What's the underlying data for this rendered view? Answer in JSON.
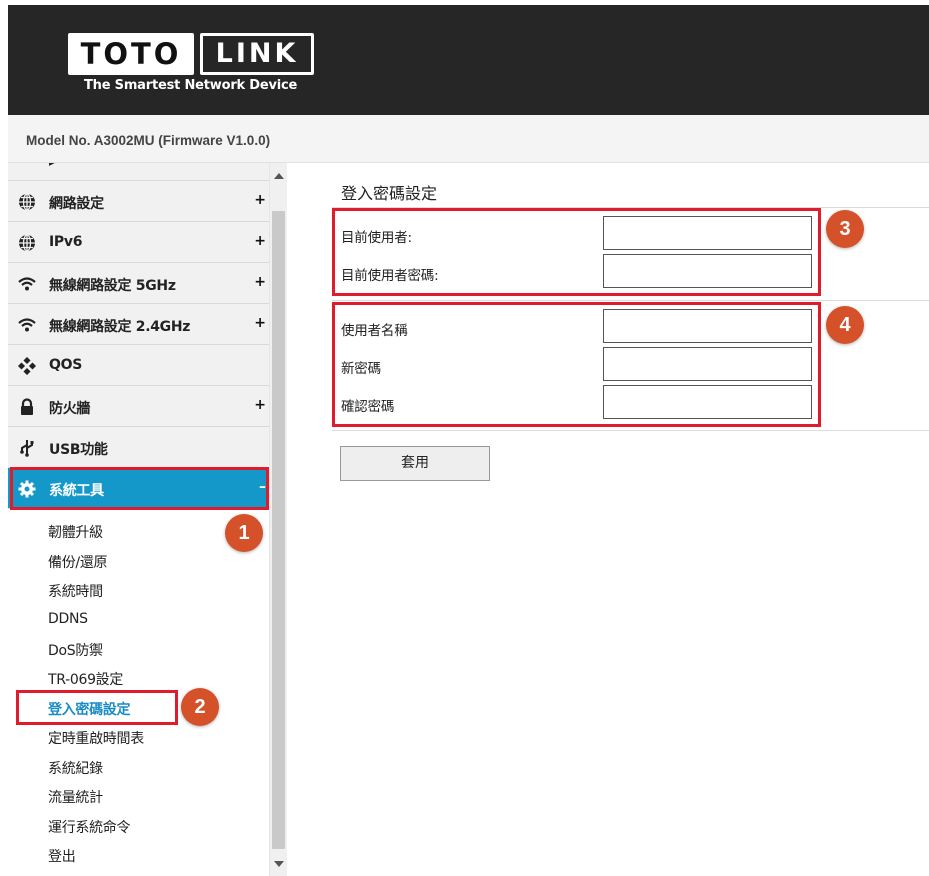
{
  "header": {
    "logo_left": "TOTO",
    "logo_right": "LINK",
    "tagline": "The Smartest Network Device",
    "model": "Model No. A3002MU (Firmware V1.0.0)"
  },
  "sidebar": {
    "items": [
      {
        "label": "網路設定",
        "icon": "globe-icon",
        "toggle": "+"
      },
      {
        "label": "IPv6",
        "icon": "globe-icon",
        "toggle": "+"
      },
      {
        "label": "無線網路設定 5GHz",
        "icon": "wifi-icon",
        "toggle": "+"
      },
      {
        "label": "無線網路設定 2.4GHz",
        "icon": "wifi-icon",
        "toggle": "+"
      },
      {
        "label": "QOS",
        "icon": "qos-icon",
        "toggle": ""
      },
      {
        "label": "防火牆",
        "icon": "lock-icon",
        "toggle": "+"
      },
      {
        "label": "USB功能",
        "icon": "usb-icon",
        "toggle": ""
      },
      {
        "label": "系統工具",
        "icon": "gear-icon",
        "toggle": "–"
      }
    ],
    "subitems": [
      "韌體升級",
      "備份/還原",
      "系統時間",
      "DDNS",
      "DoS防禦",
      "TR-069設定",
      "登入密碼設定",
      "定時重啟時間表",
      "系統紀錄",
      "流量統計",
      "運行系統命令",
      "登出"
    ]
  },
  "main": {
    "title": "登入密碼設定",
    "current_user_label": "目前使用者:",
    "current_password_label": "目前使用者密碼:",
    "username_label": "使用者名稱",
    "new_password_label": "新密碼",
    "confirm_password_label": "確認密碼",
    "apply_label": "套用"
  },
  "annotations": [
    "1",
    "2",
    "3",
    "4"
  ],
  "colors": {
    "header_bg": "#262626",
    "active_menu": "#1398c9",
    "selected_sub": "#1a8cc4",
    "annotation_red": "#e01b2c",
    "badge": "#d4512a"
  }
}
